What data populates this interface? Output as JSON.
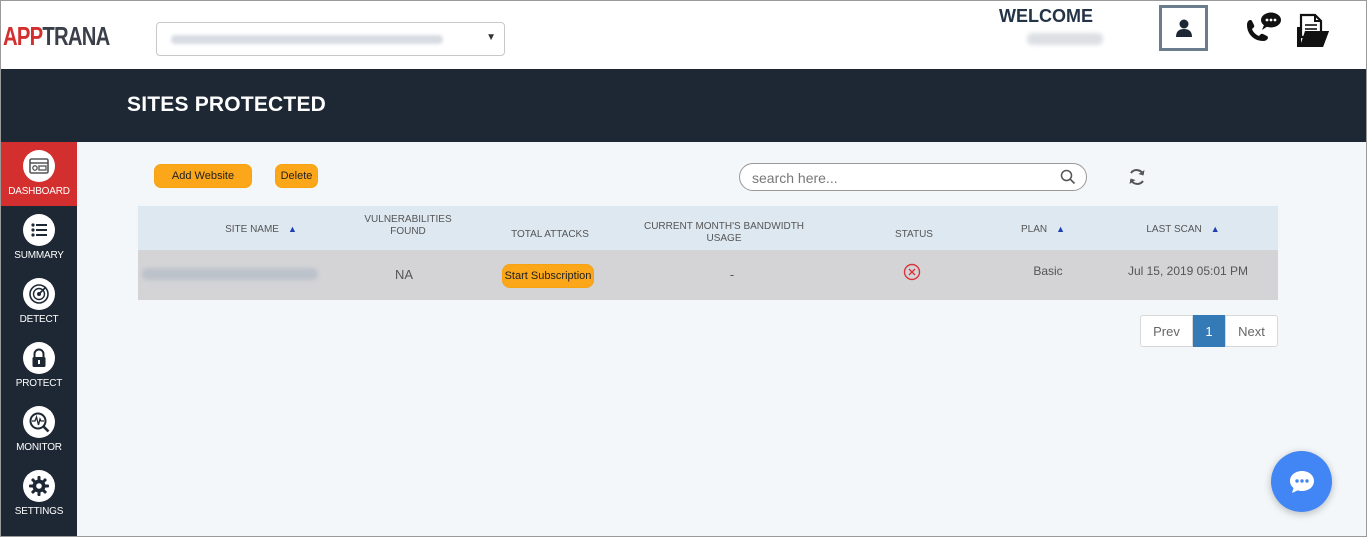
{
  "header": {
    "logo_part1": "APP",
    "logo_part2": "TRANA",
    "welcome": "WELCOME"
  },
  "page": {
    "title": "SITES PROTECTED"
  },
  "sidebar": {
    "items": [
      {
        "label": "DASHBOARD",
        "icon": "dashboard-icon",
        "active": true
      },
      {
        "label": "SUMMARY",
        "icon": "list-icon"
      },
      {
        "label": "DETECT",
        "icon": "radar-icon"
      },
      {
        "label": "PROTECT",
        "icon": "lock-icon"
      },
      {
        "label": "MONITOR",
        "icon": "monitor-icon"
      },
      {
        "label": "SETTINGS",
        "icon": "gear-icon"
      }
    ]
  },
  "toolbar": {
    "add_label": "Add Website",
    "delete_label": "Delete",
    "search_placeholder": "search here..."
  },
  "table": {
    "columns": {
      "site_name": "SITE NAME",
      "vuln_1": "VULNERABILITIES",
      "vuln_2": "FOUND",
      "total_attacks": "TOTAL ATTACKS",
      "bandwidth_1": "CURRENT MONTH'S BANDWIDTH",
      "bandwidth_2": "USAGE",
      "status": "STATUS",
      "plan": "PLAN",
      "last_scan": "LAST SCAN"
    },
    "rows": [
      {
        "vulnerabilities": "NA",
        "attacks_button": "Start Subscription",
        "bandwidth": "-",
        "plan": "Basic",
        "last_scan": "Jul 15, 2019 05:01 PM"
      }
    ]
  },
  "pagination": {
    "prev": "Prev",
    "current": "1",
    "next": "Next"
  },
  "colors": {
    "accent_orange": "#fca61a",
    "nav_dark": "#1e2835",
    "active_red": "#d32f2f",
    "pager_blue": "#337ab7"
  }
}
